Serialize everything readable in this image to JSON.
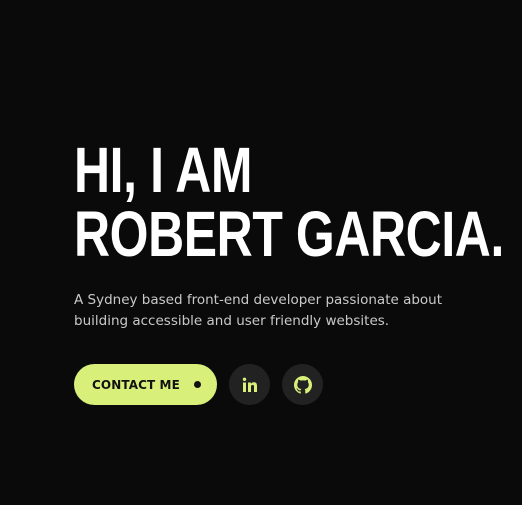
{
  "hero": {
    "headline_line1": "HI, I AM",
    "headline_line2": "ROBERT GARCIA.",
    "intro": "A Sydney based front-end developer passionate about building accessible and user friendly websites."
  },
  "actions": {
    "contact_label": "CONTACT ME",
    "social_links": [
      {
        "icon": "linkedin-icon"
      },
      {
        "icon": "github-icon"
      }
    ]
  },
  "colors": {
    "background": "#0a0a0a",
    "accent": "#d8f07a",
    "icon_button_bg": "#222222",
    "text": "#ffffff",
    "muted_text": "#c9c9c9"
  }
}
